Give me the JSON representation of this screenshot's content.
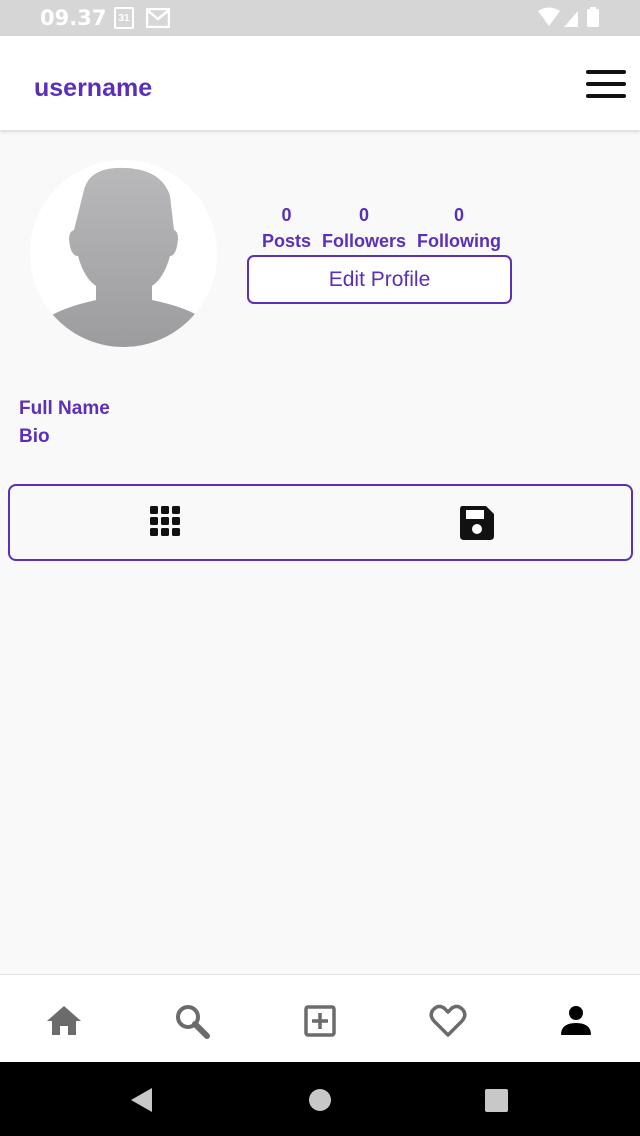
{
  "status_bar": {
    "time": "09.37",
    "calendar_day": "31"
  },
  "header": {
    "username": "username",
    "menu_icon": "hamburger-menu-icon"
  },
  "profile": {
    "avatar_icon": "default-avatar-silhouette",
    "stats": [
      {
        "count": "0",
        "label": "Posts"
      },
      {
        "count": "0",
        "label": "Followers"
      },
      {
        "count": "0",
        "label": "Following"
      }
    ],
    "edit_button_label": "Edit Profile",
    "full_name": "Full Name",
    "bio": "Bio"
  },
  "tabs": [
    {
      "icon": "grid-icon"
    },
    {
      "icon": "save-icon"
    }
  ],
  "bottom_nav": [
    {
      "icon": "home-icon"
    },
    {
      "icon": "search-icon"
    },
    {
      "icon": "add-post-icon"
    },
    {
      "icon": "heart-icon"
    },
    {
      "icon": "profile-icon",
      "active": true
    }
  ],
  "colors": {
    "accent": "#5b2fb8",
    "background": "#f9f9f9",
    "status_bar": "#d6d6d6"
  }
}
